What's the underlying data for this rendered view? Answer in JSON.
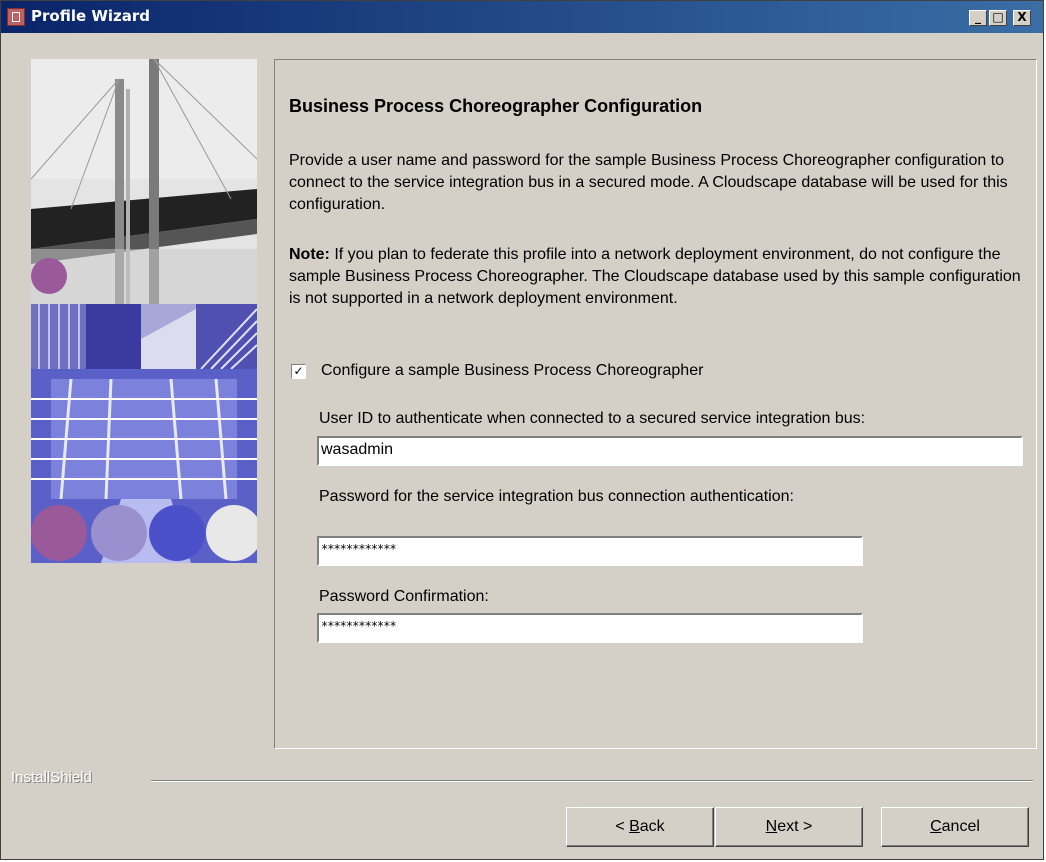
{
  "window": {
    "title": "Profile Wizard",
    "controls": {
      "minimize": "_",
      "maximize": "□",
      "close": "X"
    }
  },
  "main": {
    "heading": "Business Process Choreographer Configuration",
    "description": "Provide a user name and password for the sample Business Process Choreographer configuration to connect to the service integration bus in a secured mode. A Cloudscape database will be used for this configuration.",
    "note_label": "Note:",
    "note_text": " If you plan to federate this profile into a network deployment environment, do not configure the sample Business Process Choreographer. The Cloudscape database used by this sample configuration is not supported in a network deployment environment.",
    "checkbox": {
      "label": "Configure a sample Business Process Choreographer",
      "checked": true,
      "mark": "✓"
    },
    "fields": {
      "user_id_label": "User ID to authenticate when connected to a secured service integration bus:",
      "user_id_value": "wasadmin",
      "password_label": "Password for the service integration bus connection authentication:",
      "password_value": "************",
      "confirm_label": "Password Confirmation:",
      "confirm_value": "************"
    }
  },
  "footer": {
    "brand": "InstallShield",
    "back_prefix": "< ",
    "back_key": "B",
    "back_rest": "ack",
    "next_key": "N",
    "next_rest": "ext >",
    "cancel_key": "C",
    "cancel_rest": "ancel"
  },
  "colors": {
    "titlebar": "#0a246a",
    "dialog_bg": "#d4d0c8",
    "art_purple": "#9a5a9a",
    "art_lavender": "#9a90d0",
    "art_blue": "#4a50c8"
  }
}
